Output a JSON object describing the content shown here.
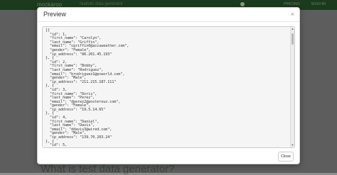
{
  "background": {
    "brand": "mockaroo",
    "tagline": "realistic data generator",
    "nav_links": [
      "PRICING",
      "SIGN IN"
    ],
    "heading": "What is test data generator?"
  },
  "modal": {
    "title": "Preview",
    "close_icon": "×",
    "code": "[{\n  \"id\": 1,\n  \"first_name\": \"Carolyn\",\n  \"last_name\": \"Griffin\",\n  \"email\": \"cgriffin0@accuweather.com\",\n  \"gender\": \"Female\",\n  \"ip_address\": \"86.201.45.193\"\n}, {\n  \"id\": 2,\n  \"first_name\": \"Bobby\",\n  \"last_name\": \"Rodriguez\",\n  \"email\": \"brodriguez1@pcworld.com\",\n  \"gender\": \"Male\",\n  \"ip_address\": \"211.215.187.111\"\n}, {\n  \"id\": 3,\n  \"first_name\": \"Doris\",\n  \"last_name\": \"Perez\",\n  \"email\": \"dperez2@posterous.com\",\n  \"gender\": \"Female\",\n  \"ip_address\": \"19.5.14.65\"\n}, {\n  \"id\": 4,\n  \"first_name\": \"Daniel\",\n  \"last_name\": \"Davis\",\n  \"email\": \"ddavis3@wired.com\",\n  \"gender\": \"Male\",\n  \"ip_address\": \"139.70.203.24\"\n}, {\n  \"id\": 5,\n  \"first_name\": \"Karen\",\n  \"last_name\": \"Parker\",",
    "close_label": "Close"
  }
}
